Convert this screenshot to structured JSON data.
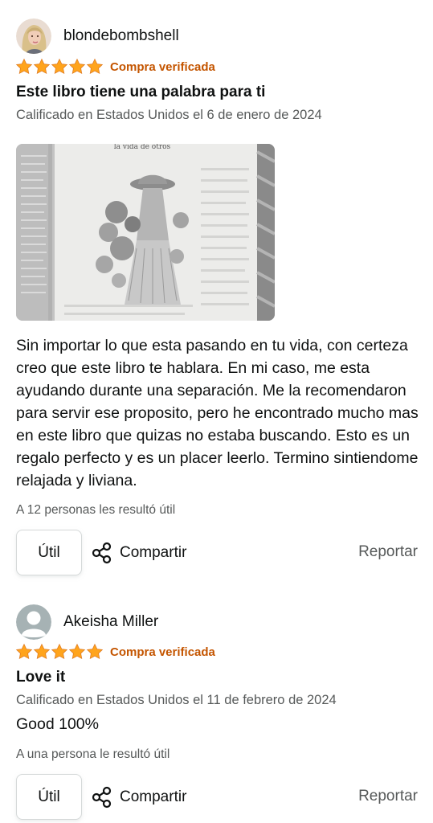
{
  "reviews": [
    {
      "author": "blondebombshell",
      "stars": 5,
      "verified_label": "Compra verificada",
      "title": "Este libro tiene una palabra para ti",
      "date": "Calificado en Estados Unidos el 6 de enero de 2024",
      "photo_caption": "la vida de otros",
      "body": "Sin importar lo que esta pasando en tu vida, con certeza creo que este libro te hablara. En mi caso, me esta ayudando durante una separación. Me la recomendaron para servir ese proposito, pero he encontrado mucho mas en este libro que quizas no estaba buscando. Esto es un regalo perfecto y es un placer leerlo. Termino sintiendome relajada y liviana.",
      "helpful": "A 12 personas les resultó útil",
      "helpful_button": "Útil",
      "share_label": "Compartir",
      "report_label": "Reportar"
    },
    {
      "author": "Akeisha Miller",
      "stars": 5,
      "verified_label": "Compra verificada",
      "title": "Love it",
      "date": "Calificado en Estados Unidos el 11 de febrero de 2024",
      "body": "Good 100%",
      "helpful": "A una persona le resultó útil",
      "helpful_button": "Útil",
      "share_label": "Compartir",
      "report_label": "Reportar"
    }
  ],
  "colors": {
    "star": "#ffa41c",
    "verified": "#c45500",
    "secondary_text": "#565959",
    "primary_text": "#0f1111",
    "border": "#d5d9d9"
  },
  "icons": {
    "star": "star-icon",
    "share": "share-icon",
    "avatar_default": "user-silhouette-icon"
  }
}
